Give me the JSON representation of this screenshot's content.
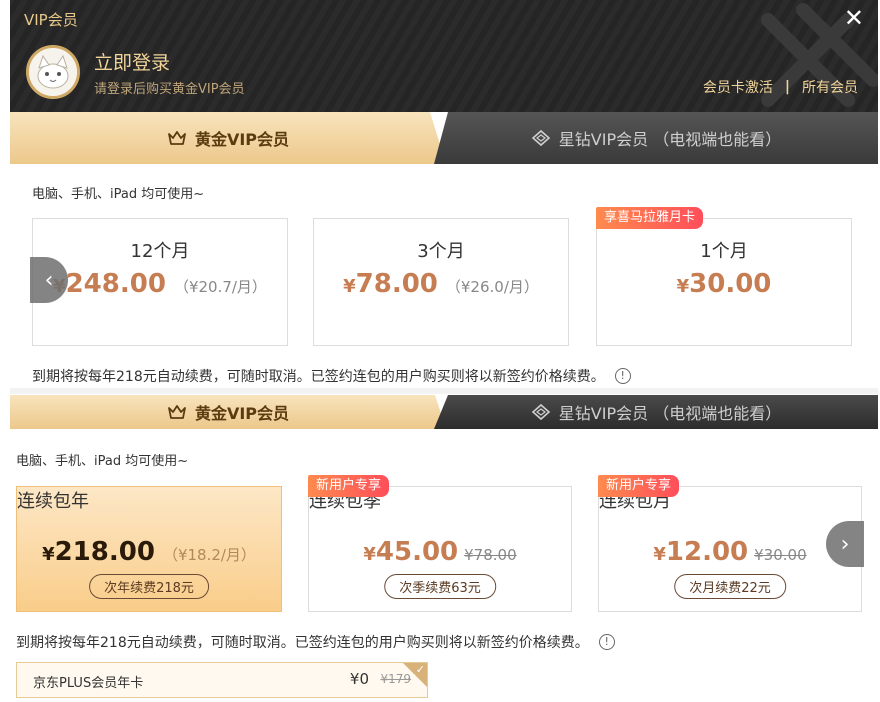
{
  "header": {
    "title": "VIP会员",
    "login_text": "立即登录",
    "login_sub": "请登录后购买黄金VIP会员",
    "link_activate": "会员卡激活",
    "link_separator": "|",
    "link_all": "所有会员",
    "close_symbol": "✕"
  },
  "tabs": {
    "gold": "黄金VIP会员",
    "star": "星钻VIP会员 （电视端也能看）"
  },
  "top_section": {
    "device_text": "电脑、手机、iPad 均可使用~",
    "plans": [
      {
        "period": "12个月",
        "yen": "¥",
        "amount": "248.00",
        "per_month": "（¥20.7/月）",
        "tag": ""
      },
      {
        "period": "3个月",
        "yen": "¥",
        "amount": "78.00",
        "per_month": "（¥26.0/月）",
        "tag": ""
      },
      {
        "period": "1个月",
        "yen": "¥",
        "amount": "30.00",
        "per_month": "",
        "tag": "享喜马拉雅月卡"
      }
    ],
    "renew_note": "到期将按每年218元自动续费，可随时取消。已签约连包的用户购买则将以新签约价格续费。",
    "info_symbol": "!"
  },
  "bottom_section": {
    "device_text": "电脑、手机、iPad 均可使用~",
    "plans": [
      {
        "period": "连续包年",
        "yen": "¥",
        "amount": "218.00",
        "per_month": "（¥18.2/月）",
        "old_price": "",
        "renew": "次年续费218元",
        "tag": ""
      },
      {
        "period": "连续包季",
        "yen": "¥",
        "amount": "45.00",
        "per_month": "",
        "old_price": "¥78.00",
        "renew": "次季续费63元",
        "tag": "新用户专享"
      },
      {
        "period": "连续包月",
        "yen": "¥",
        "amount": "12.00",
        "per_month": "",
        "old_price": "¥30.00",
        "renew": "次月续费22元",
        "tag": "新用户专享"
      }
    ],
    "renew_note": "到期将按每年218元自动续费，可随时取消。已签约连包的用户购买则将以新签约价格续费。",
    "info_symbol": "!",
    "jd_plus": {
      "label": "京东PLUS会员年卡",
      "price": "¥0",
      "old_price": "¥179"
    }
  },
  "colors": {
    "gold_tab": "#ecc88b",
    "price": "#c77d52",
    "tag_start": "#ff8a4e",
    "tag_end": "#ff4e5a",
    "header_bg": "#262626"
  },
  "icons": {
    "arrow_left": "‹",
    "arrow_right": "›",
    "check": "✓"
  }
}
